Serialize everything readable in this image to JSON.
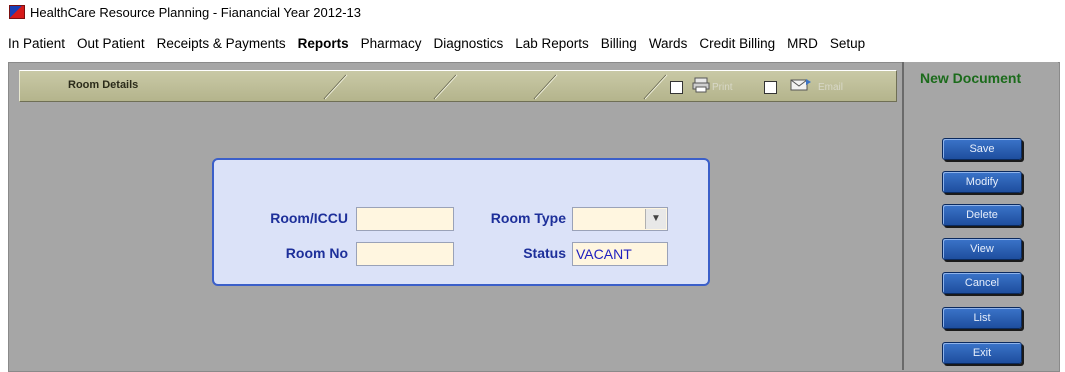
{
  "window": {
    "title": "HealthCare Resource Planning - Fianancial Year 2012-13"
  },
  "menu": {
    "items": [
      "In Patient",
      "Out Patient",
      "Receipts & Payments",
      "Reports",
      "Pharmacy",
      "Diagnostics",
      "Lab Reports",
      "Billing",
      "Wards",
      "Credit Billing",
      "MRD",
      "Setup"
    ],
    "active": "Reports"
  },
  "header": {
    "title": "Room Details",
    "print_label": "Print",
    "email_label": "Email"
  },
  "side": {
    "status": "New Document",
    "buttons": {
      "save": "Save",
      "modify": "Modify",
      "delete": "Delete",
      "view": "View",
      "cancel": "Cancel",
      "list": "List",
      "exit": "Exit"
    }
  },
  "form": {
    "room_icu_label": "Room/ICCU",
    "room_icu_value": "",
    "room_type_label": "Room Type",
    "room_type_value": "",
    "room_no_label": "Room No",
    "room_no_value": "",
    "status_label": "Status",
    "status_value": "VACANT"
  },
  "colors": {
    "accent_blue": "#1d2f9a",
    "button_blue": "#2b62b8",
    "new_doc_green": "#1b6b1b",
    "panel_bg": "#dbe2f8"
  }
}
